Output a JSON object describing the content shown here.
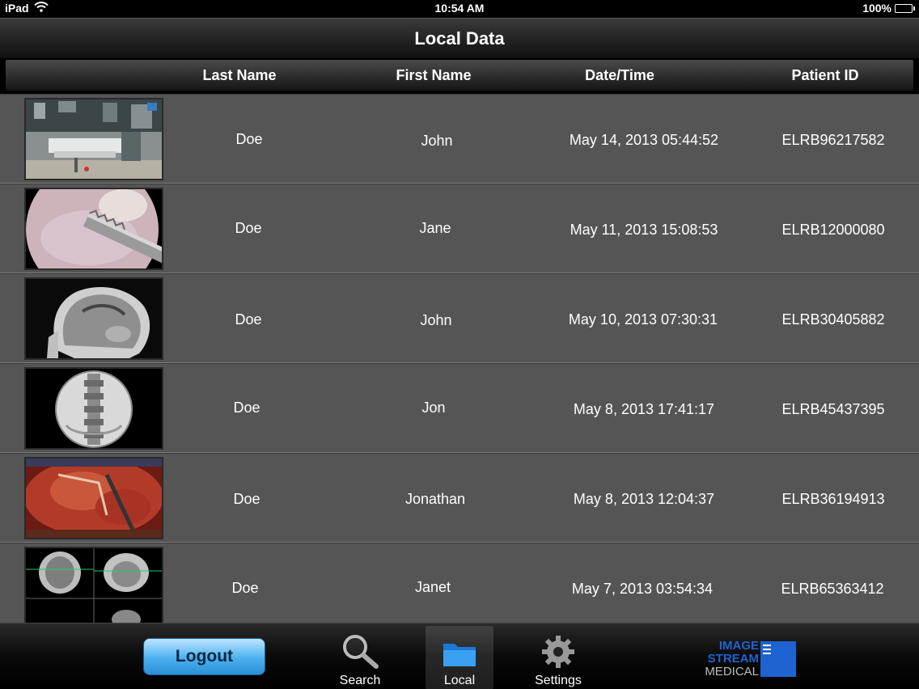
{
  "status_bar": {
    "device": "iPad",
    "time": "10:54 AM",
    "battery": "100%"
  },
  "nav": {
    "title": "Local Data"
  },
  "columns": {
    "last_name": "Last Name",
    "first_name": "First Name",
    "date_time": "Date/Time",
    "patient_id": "Patient ID"
  },
  "rows": [
    {
      "last": "Doe",
      "first": "John",
      "date": "May 14, 2013 05:44:52",
      "id": "ELRB96217582",
      "thumb": "operating-room"
    },
    {
      "last": "Doe",
      "first": "Jane",
      "date": "May 11, 2013 15:08:53",
      "id": "ELRB12000080",
      "thumb": "arthroscopy"
    },
    {
      "last": "Doe",
      "first": "John",
      "date": "May 10, 2013 07:30:31",
      "id": "ELRB30405882",
      "thumb": "mri-sagittal-head"
    },
    {
      "last": "Doe",
      "first": "Jon",
      "date": "May 8, 2013 17:41:17",
      "id": "ELRB45437395",
      "thumb": "fluoroscopy-spine"
    },
    {
      "last": "Doe",
      "first": "Jonathan",
      "date": "May 8, 2013 12:04:37",
      "id": "ELRB36194913",
      "thumb": "surgical-field"
    },
    {
      "last": "Doe",
      "first": "Janet",
      "date": "May 7, 2013 03:54:34",
      "id": "ELRB65363412",
      "thumb": "brain-mri-grid"
    }
  ],
  "tab_bar": {
    "logout": "Logout",
    "search": "Search",
    "local": "Local",
    "settings": "Settings",
    "logo": {
      "line1": "IMAGE",
      "line2": "STREAM",
      "line3": "MEDICAL"
    }
  },
  "colors": {
    "accent": "#4ab0ef",
    "brand": "#1e63d0",
    "row_bg": "#555555"
  }
}
